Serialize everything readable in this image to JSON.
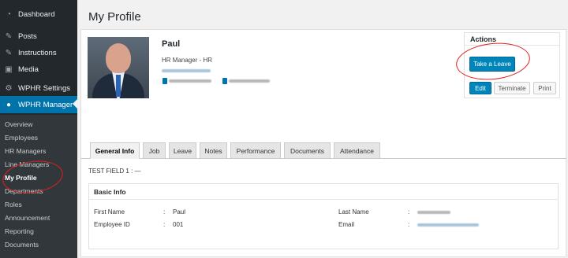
{
  "sidebar": {
    "menu": [
      {
        "label": "Dashboard",
        "icon": "dashboard-icon"
      },
      {
        "label": "Posts",
        "icon": "pin-icon"
      },
      {
        "label": "Instructions",
        "icon": "pin-icon"
      },
      {
        "label": "Media",
        "icon": "media-icon"
      },
      {
        "label": "WPHR Settings",
        "icon": "gear-icon"
      },
      {
        "label": "WPHR Manager",
        "icon": "user-circle-icon"
      }
    ],
    "submenu": [
      "Overview",
      "Employees",
      "HR Managers",
      "Line Managers",
      "My Profile",
      "Departments",
      "Roles",
      "Announcement",
      "Reporting",
      "Documents"
    ]
  },
  "page": {
    "title": "My Profile"
  },
  "profile": {
    "name": "Paul",
    "job": "HR Manager - HR"
  },
  "actions": {
    "title": "Actions",
    "take_leave": "Take a Leave",
    "edit": "Edit",
    "terminate": "Terminate",
    "print": "Print"
  },
  "tabs": [
    "General Info",
    "Job",
    "Leave",
    "Notes",
    "Performance",
    "Documents",
    "Attendance"
  ],
  "test_field": "TEST FIELD 1 : —",
  "basic_info": {
    "title": "Basic Info",
    "first_name_label": "First Name",
    "first_name_value": "Paul",
    "employee_id_label": "Employee ID",
    "employee_id_value": "001",
    "last_name_label": "Last Name",
    "email_label": "Email",
    "separator": ":"
  },
  "colors": {
    "accent": "#0073aa",
    "sidebar": "#23282d",
    "annotation": "#e0201c"
  }
}
